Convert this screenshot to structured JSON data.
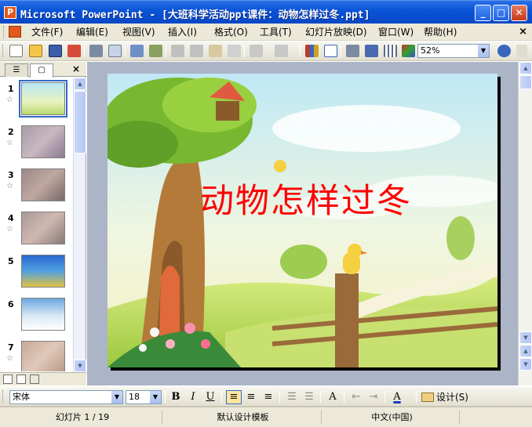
{
  "window": {
    "title": "Microsoft PowerPoint - [大班科学活动ppt课件：动物怎样过冬.ppt]",
    "app_icon_letter": "P",
    "minimize_glyph": "_",
    "maximize_glyph": "□",
    "close_glyph": "✕"
  },
  "menubar": {
    "items": [
      "文件(F)",
      "编辑(E)",
      "视图(V)",
      "插入(I)",
      "格式(O)",
      "工具(T)",
      "幻灯片放映(D)",
      "窗口(W)",
      "帮助(H)"
    ],
    "close_glyph": "×"
  },
  "standard_toolbar": {
    "zoom": "52%"
  },
  "outline_pane": {
    "tab_outline_glyph": "☰",
    "tab_slides_glyph": "▢",
    "close_glyph": "×",
    "slides": [
      {
        "number": "1",
        "star": "☆"
      },
      {
        "number": "2",
        "star": "☆"
      },
      {
        "number": "3",
        "star": "☆"
      },
      {
        "number": "4",
        "star": "☆"
      },
      {
        "number": "5",
        "star": ""
      },
      {
        "number": "6",
        "star": ""
      },
      {
        "number": "7",
        "star": "☆"
      }
    ]
  },
  "slide": {
    "title": "动物怎样过冬"
  },
  "format_toolbar": {
    "font_name": "宋体",
    "font_size": "18",
    "bold": "B",
    "italic": "I",
    "underline": "U",
    "design_label": "设计(S)"
  },
  "statusbar": {
    "slide_position": "幻灯片 1 / 19",
    "template": "默认设计模板",
    "language": "中文(中国)"
  },
  "colors": {
    "title_red": "#ff0000",
    "titlebar_blue": "#0a55d8",
    "workspace_gray": "#acb4c7"
  }
}
